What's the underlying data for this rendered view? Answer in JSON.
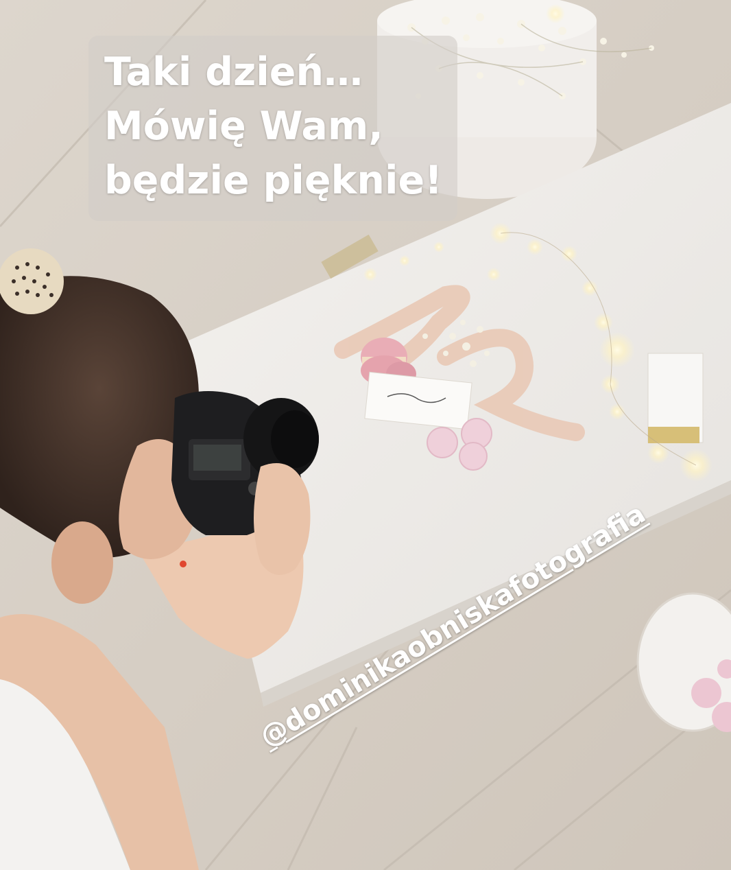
{
  "story": {
    "caption_lines": [
      "Taki dzień…",
      "Mówię Wam,",
      "będzie pięknie!"
    ],
    "mention": "@dominikaobniskafotografia"
  },
  "scene": {
    "subject": "photographer-with-camera",
    "props": [
      "white-tabletop",
      "fairy-lights",
      "gypsophila-box",
      "macarons",
      "silk-ribbon",
      "meringues",
      "name-cards",
      "saucer"
    ]
  }
}
